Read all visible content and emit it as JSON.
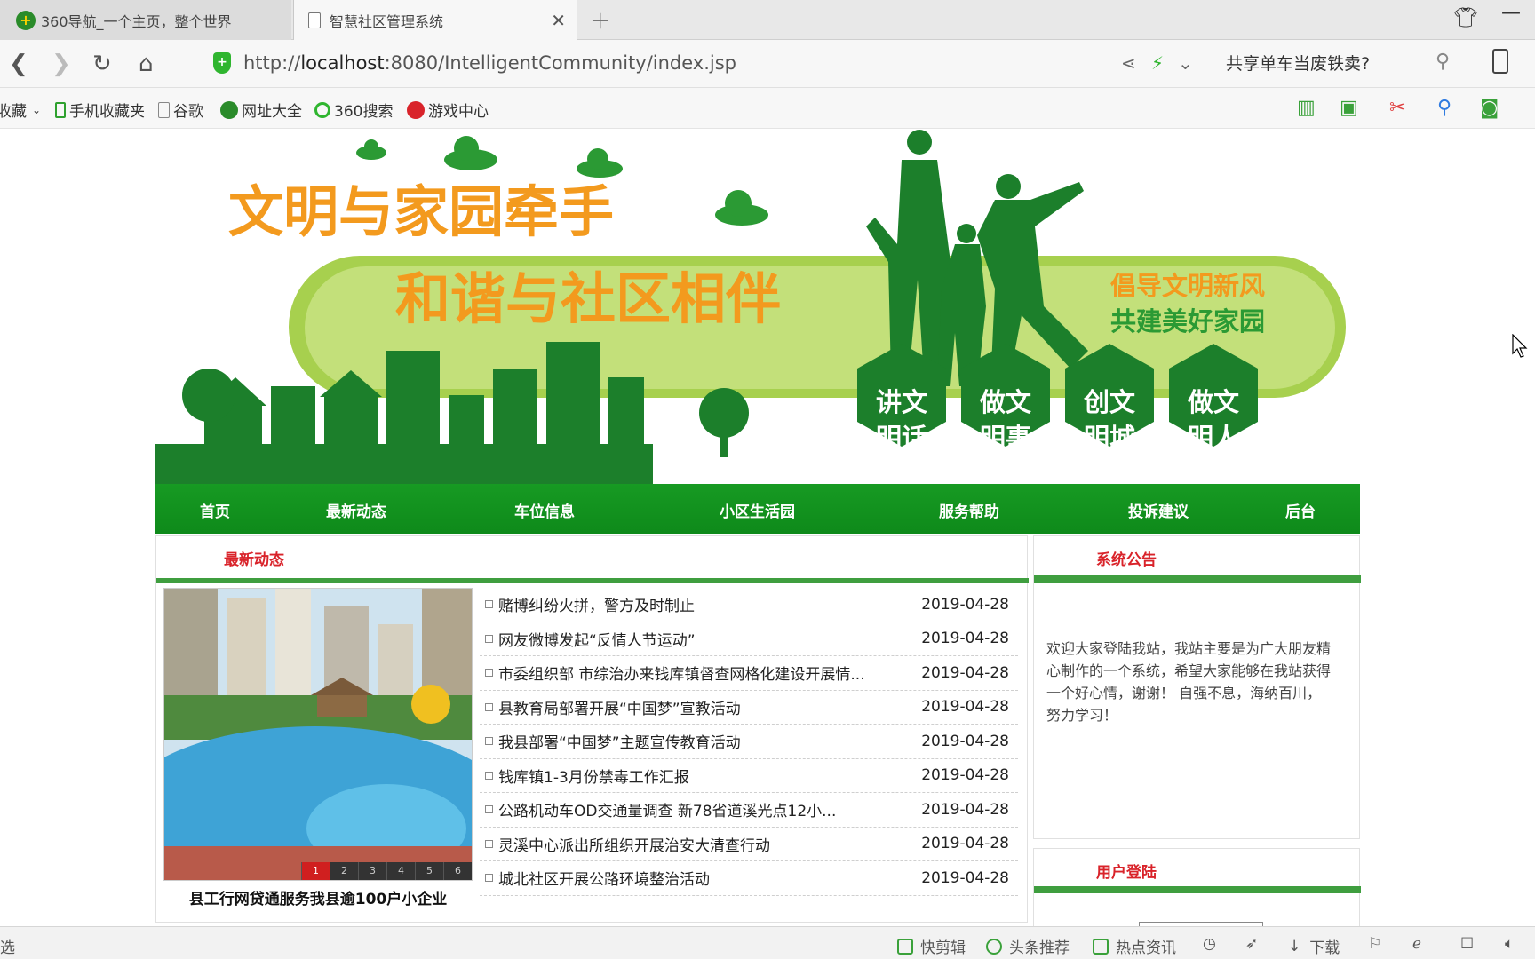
{
  "browser": {
    "tabs": [
      {
        "label": "360导航_一个主页，整个世界",
        "active": false
      },
      {
        "label": "智慧社区管理系统",
        "active": true
      }
    ],
    "url_prefix": "http://",
    "url_host": "localhost",
    "url_rest": ":8080/IntelligentCommunity/index.jsp",
    "search_suggestion": "共享单车当废铁卖?",
    "bookmarks": [
      "收藏",
      "手机收藏夹",
      "谷歌",
      "网址大全",
      "360搜索",
      "游戏中心"
    ],
    "status_items": [
      "快剪辑",
      "头条推荐",
      "热点资讯",
      "下载"
    ],
    "status_left": "选"
  },
  "banner": {
    "headline": "文明与家园牵手",
    "subheadline": "和谐与社区相伴",
    "slogan_line1": "倡导文明新风",
    "slogan_line2": "共建美好家园",
    "hexagons": [
      "讲文明话",
      "做文明事",
      "创文明城",
      "做文明人"
    ],
    "colors": {
      "green": "#1a8a2a",
      "light_green": "#a5cf4f",
      "orange": "#f39a1e"
    }
  },
  "nav": {
    "items": [
      "首页",
      "最新动态",
      "车位信息",
      "小区生活园",
      "服务帮助",
      "投诉建议",
      "后台"
    ]
  },
  "news": {
    "title": "最新动态",
    "photo_caption": "县工行网贷通服务我县逾100户小企业",
    "pager": [
      "1",
      "2",
      "3",
      "4",
      "5",
      "6"
    ],
    "items": [
      {
        "title": "赌博纠纷火拼，警方及时制止",
        "date": "2019-04-28"
      },
      {
        "title": "网友微博发起“反情人节运动”",
        "date": "2019-04-28"
      },
      {
        "title": "市委组织部 市综治办来钱库镇督查网格化建设开展情...",
        "date": "2019-04-28"
      },
      {
        "title": "县教育局部署开展“中国梦”宣教活动",
        "date": "2019-04-28"
      },
      {
        "title": "我县部署“中国梦”主题宣传教育活动",
        "date": "2019-04-28"
      },
      {
        "title": "钱库镇1-3月份禁毒工作汇报",
        "date": "2019-04-28"
      },
      {
        "title": "公路机动车OD交通量调查 新78省道溪光点12小...",
        "date": "2019-04-28"
      },
      {
        "title": "灵溪中心派出所组织开展治安大清查行动",
        "date": "2019-04-28"
      },
      {
        "title": "城北社区开展公路环境整治活动",
        "date": "2019-04-28"
      }
    ]
  },
  "sidebar": {
    "notice_title": "系统公告",
    "notice_text": "欢迎大家登陆我站，我站主要是为广大朋友精心制作的一个系统，希望大家能够在我站获得一个好心情，谢谢！ 自强不息，海纳百川，努力学习！",
    "login_title": "用户登陆"
  }
}
